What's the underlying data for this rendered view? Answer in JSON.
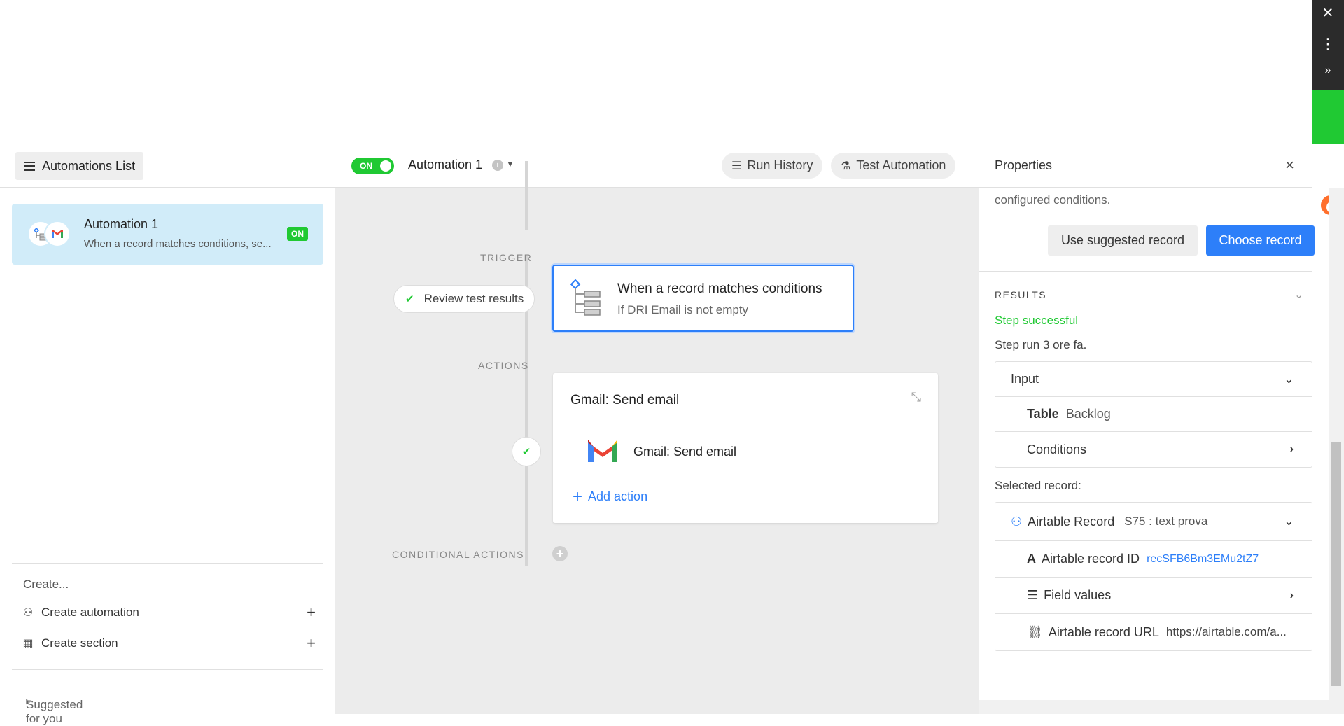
{
  "left": {
    "list_button": "Automations List",
    "automation": {
      "name": "Automation 1",
      "desc": "When a record matches conditions, se...",
      "status": "ON"
    },
    "create_label": "Create...",
    "create_automation": "Create automation",
    "create_section": "Create section",
    "suggested": "Suggested for you"
  },
  "header": {
    "toggle": "ON",
    "title": "Automation 1",
    "run_history": "Run History",
    "test_automation": "Test Automation"
  },
  "canvas": {
    "trigger_label": "TRIGGER",
    "actions_label": "ACTIONS",
    "conditional_label": "CONDITIONAL ACTIONS",
    "review_btn": "Review test results",
    "trigger_title": "When a record matches conditions",
    "trigger_sub": "If DRI Email is not empty",
    "action_title": "Gmail: Send email",
    "action_row": "Gmail: Send email",
    "add_action": "Add action"
  },
  "properties": {
    "title": "Properties",
    "note": "configured conditions.",
    "use_suggested": "Use suggested record",
    "choose_record": "Choose record",
    "results_label": "RESULTS",
    "step_status": "Step successful",
    "step_run": "Step run 3 ore fa.",
    "input_label": "Input",
    "table_key": "Table",
    "table_val": "Backlog",
    "conditions": "Conditions",
    "selected_record": "Selected record:",
    "airtable_record": "Airtable Record",
    "record_name": "S75 : text prova",
    "record_id_key": "Airtable record ID",
    "record_id_val": "recSFB6Bm3EMu2tZ7",
    "field_values": "Field values",
    "record_url_key": "Airtable record URL",
    "record_url_val": "https://airtable.com/a..."
  },
  "colors": {
    "accent_blue": "#2d7ff9",
    "green": "#20c933",
    "selected_bg": "#d1ecf9"
  }
}
